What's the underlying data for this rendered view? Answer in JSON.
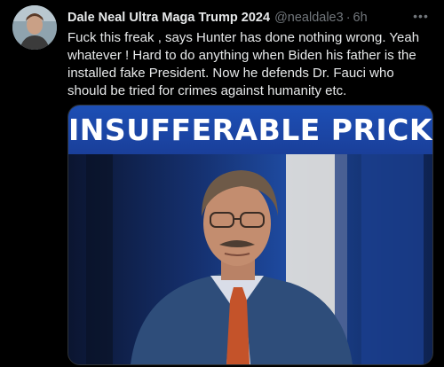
{
  "tweet": {
    "author_name": "Dale Neal Ultra Maga Trump 2024",
    "handle": "@nealdale3",
    "separator": "·",
    "time": "6h",
    "text": "Fuck this freak , says Hunter has done nothing wrong. Yeah whatever ! Hard to do anything when Biden his father is the installed fake President. Now he defends Dr. Fauci who should be tried for crimes against humanity etc.",
    "more_icon": "ellipsis-icon"
  },
  "media": {
    "banner_text": "INSUFFERABLE PRICK",
    "banner_color": "#1d4fb5"
  },
  "colors": {
    "background": "#000000",
    "text": "#e7e9ea",
    "secondary": "#71767b"
  }
}
